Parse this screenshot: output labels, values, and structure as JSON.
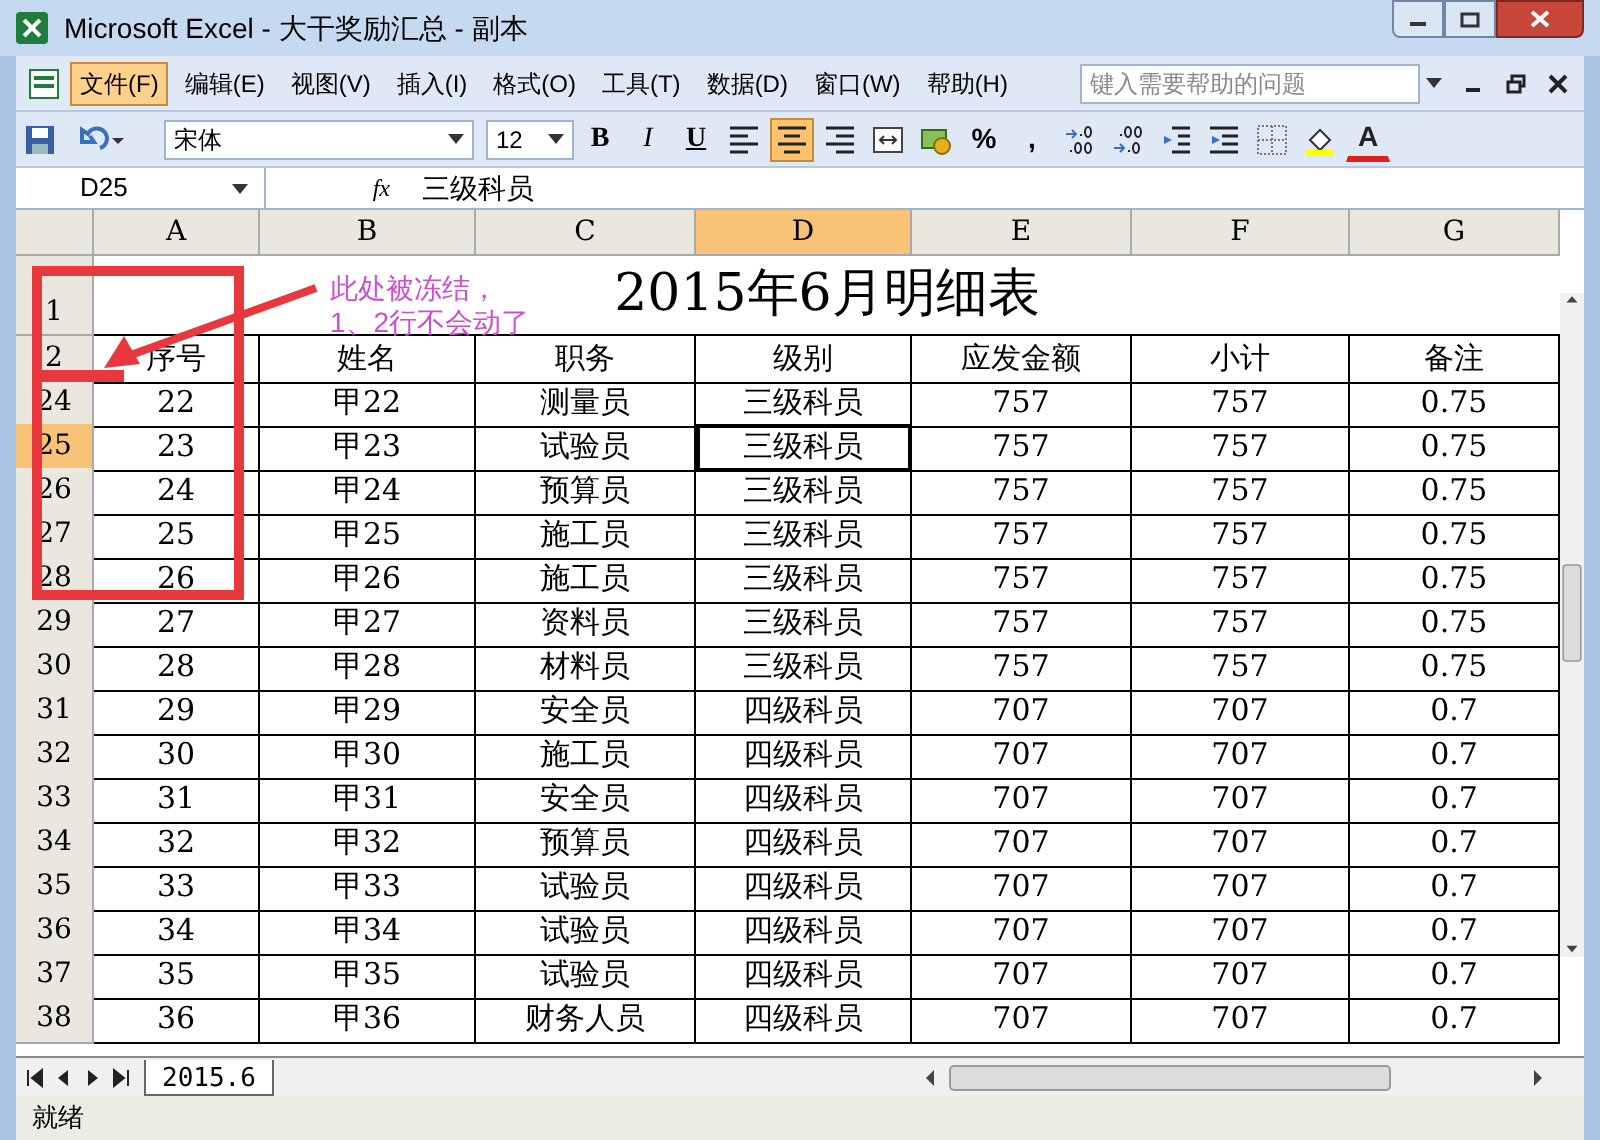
{
  "window": {
    "title": "Microsoft Excel - 大干奖励汇总 - 副本"
  },
  "menu": [
    {
      "label": "文件(F)",
      "selected": true
    },
    {
      "label": "编辑(E)",
      "selected": false
    },
    {
      "label": "视图(V)",
      "selected": false
    },
    {
      "label": "插入(I)",
      "selected": false
    },
    {
      "label": "格式(O)",
      "selected": false
    },
    {
      "label": "工具(T)",
      "selected": false
    },
    {
      "label": "数据(D)",
      "selected": false
    },
    {
      "label": "窗口(W)",
      "selected": false
    },
    {
      "label": "帮助(H)",
      "selected": false
    }
  ],
  "help_box": {
    "placeholder": "键入需要帮助的问题"
  },
  "toolbar": {
    "font": "宋体",
    "size": "12",
    "buttons": [
      {
        "kind": "bold",
        "label": "B",
        "selected": false
      },
      {
        "kind": "italic",
        "label": "I",
        "selected": false
      },
      {
        "kind": "underline",
        "label": "U",
        "selected": false
      },
      {
        "kind": "align-left",
        "selected": false
      },
      {
        "kind": "align-center",
        "selected": true
      },
      {
        "kind": "align-right",
        "selected": false
      },
      {
        "kind": "merge",
        "selected": false
      },
      {
        "kind": "currency",
        "selected": false
      },
      {
        "kind": "text",
        "label": "%",
        "selected": false
      },
      {
        "kind": "text",
        "label": ",",
        "selected": false
      },
      {
        "kind": "inc-decimal",
        "selected": false
      },
      {
        "kind": "dec-decimal",
        "selected": false
      },
      {
        "kind": "outdent",
        "selected": false
      },
      {
        "kind": "indent",
        "selected": false
      },
      {
        "kind": "borders",
        "selected": false
      },
      {
        "kind": "fill",
        "selected": false
      },
      {
        "kind": "font-color",
        "label": "A",
        "selected": false
      }
    ]
  },
  "formula_bar": {
    "name_box": "D25",
    "fx": "fx",
    "value": "三级科员"
  },
  "columns": [
    {
      "label": "A",
      "selected": false
    },
    {
      "label": "B",
      "selected": false
    },
    {
      "label": "C",
      "selected": false
    },
    {
      "label": "D",
      "selected": true
    },
    {
      "label": "E",
      "selected": false
    },
    {
      "label": "F",
      "selected": false
    },
    {
      "label": "G",
      "selected": false
    }
  ],
  "title_row": {
    "row": "1",
    "title": "2015年6月明细表"
  },
  "header_row": {
    "row": "2",
    "cells": [
      "序号",
      "姓名",
      "职务",
      "级别",
      "应发金额",
      "小计",
      "备注"
    ]
  },
  "rows": [
    {
      "row": "24",
      "selected": false,
      "cells": [
        "22",
        "甲22",
        "测量员",
        "三级科员",
        "757",
        "757",
        "0.75"
      ]
    },
    {
      "row": "25",
      "selected": true,
      "cells": [
        "23",
        "甲23",
        "试验员",
        "三级科员",
        "757",
        "757",
        "0.75"
      ]
    },
    {
      "row": "26",
      "selected": false,
      "cells": [
        "24",
        "甲24",
        "预算员",
        "三级科员",
        "757",
        "757",
        "0.75"
      ]
    },
    {
      "row": "27",
      "selected": false,
      "cells": [
        "25",
        "甲25",
        "施工员",
        "三级科员",
        "757",
        "757",
        "0.75"
      ]
    },
    {
      "row": "28",
      "selected": false,
      "cells": [
        "26",
        "甲26",
        "施工员",
        "三级科员",
        "757",
        "757",
        "0.75"
      ]
    },
    {
      "row": "29",
      "selected": false,
      "cells": [
        "27",
        "甲27",
        "资料员",
        "三级科员",
        "757",
        "757",
        "0.75"
      ]
    },
    {
      "row": "30",
      "selected": false,
      "cells": [
        "28",
        "甲28",
        "材料员",
        "三级科员",
        "757",
        "757",
        "0.75"
      ]
    },
    {
      "row": "31",
      "selected": false,
      "cells": [
        "29",
        "甲29",
        "安全员",
        "四级科员",
        "707",
        "707",
        "0.7"
      ]
    },
    {
      "row": "32",
      "selected": false,
      "cells": [
        "30",
        "甲30",
        "施工员",
        "四级科员",
        "707",
        "707",
        "0.7"
      ]
    },
    {
      "row": "33",
      "selected": false,
      "cells": [
        "31",
        "甲31",
        "安全员",
        "四级科员",
        "707",
        "707",
        "0.7"
      ]
    },
    {
      "row": "34",
      "selected": false,
      "cells": [
        "32",
        "甲32",
        "预算员",
        "四级科员",
        "707",
        "707",
        "0.7"
      ]
    },
    {
      "row": "35",
      "selected": false,
      "cells": [
        "33",
        "甲33",
        "试验员",
        "四级科员",
        "707",
        "707",
        "0.7"
      ]
    },
    {
      "row": "36",
      "selected": false,
      "cells": [
        "34",
        "甲34",
        "试验员",
        "四级科员",
        "707",
        "707",
        "0.7"
      ]
    },
    {
      "row": "37",
      "selected": false,
      "cells": [
        "35",
        "甲35",
        "试验员",
        "四级科员",
        "707",
        "707",
        "0.7"
      ]
    },
    {
      "row": "38",
      "selected": false,
      "cells": [
        "36",
        "甲36",
        "财务人员",
        "四级科员",
        "707",
        "707",
        "0.7"
      ]
    }
  ],
  "sheet_tabs": [
    {
      "label": "2015.6",
      "selected": true
    }
  ],
  "status_bar": {
    "text": "就绪"
  },
  "annotation": {
    "lines": [
      "此处被冻结，",
      "1、2行不会动了"
    ]
  }
}
